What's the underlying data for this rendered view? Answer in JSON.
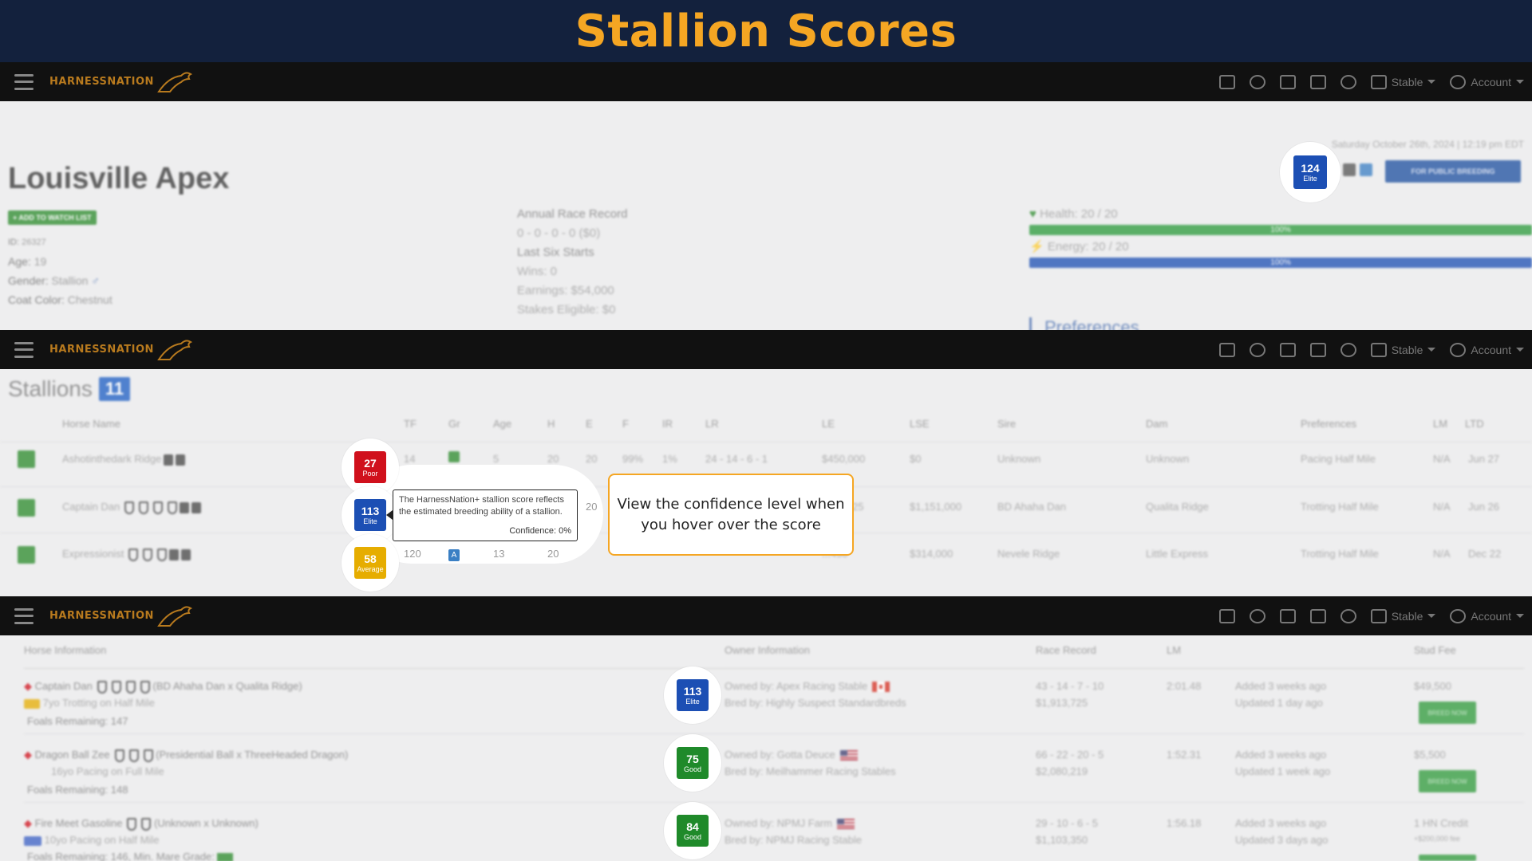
{
  "banner_title": "Stallion Scores",
  "nav": {
    "logo_text": "HARNESSNATION",
    "stable_label": "Stable",
    "account_label": "Account"
  },
  "horse_page": {
    "date": "Saturday October 26th, 2024 | 12:19 pm EDT",
    "name": "Louisville Apex",
    "watch_label": "+ ADD TO WATCH LIST",
    "id_label": "ID:",
    "id_value": "26327",
    "age_label": "Age:",
    "age_value": "19",
    "gender_label": "Gender:",
    "gender_value": "Stallion",
    "coat_label": "Coat Color:",
    "coat_value": "Chestnut",
    "annual_record_label": "Annual Race Record",
    "annual_record_value": "0 - 0 - 0 - 0 ($0)",
    "last_six_label": "Last Six Starts",
    "wins": "Wins: 0",
    "earnings": "Earnings: $54,000",
    "stakes": "Stakes Eligible: $0",
    "health_label": "Health: 20 / 20",
    "health_pct": "100%",
    "energy_label": "Energy: 20 / 20",
    "energy_pct": "100%",
    "preferences_label": "Preferences",
    "public_breeding_label": "FOR PUBLIC BREEDING",
    "score": {
      "value": "124",
      "label": "Elite"
    }
  },
  "stallions": {
    "title": "Stallions",
    "count": "11",
    "columns": [
      "Horse Name",
      "TF",
      "Gr",
      "Age",
      "H",
      "E",
      "F",
      "IR",
      "LR",
      "LE",
      "LSE",
      "Sire",
      "Dam",
      "Preferences",
      "LM",
      "LTD"
    ],
    "rows": [
      {
        "name": "Ashotinthedark Ridge",
        "tf": "14",
        "age": "5",
        "h": "20",
        "e": "20",
        "f": "99%",
        "ir": "1%",
        "lr": "24 - 14 - 6 - 1",
        "le": "$450,000",
        "lse": "$0",
        "sire": "Unknown",
        "dam": "Unknown",
        "pref": "Pacing Half Mile",
        "lm": "N/A",
        "ltd": "Jun 27",
        "score": "27",
        "score_label": "Poor"
      },
      {
        "name": "Captain Dan",
        "tf": "",
        "age": "",
        "h": "",
        "e": "20",
        "f": "",
        "ir": "",
        "lr": "",
        "le": "...725",
        "lse": "$1,151,000",
        "sire": "BD Ahaha Dan",
        "dam": "Qualita Ridge",
        "pref": "Trotting Half Mile",
        "lm": "N/A",
        "ltd": "Jun 26",
        "score": "113",
        "score_label": "Elite"
      },
      {
        "name": "Expressionist",
        "tf": "120",
        "age": "13",
        "h": "20",
        "e": "20",
        "f": "",
        "ir": "",
        "lr": "",
        "le": "...450",
        "lse": "$314,000",
        "sire": "Nevele Ridge",
        "dam": "Little Express",
        "pref": "Trotting Half Mile",
        "lm": "N/A",
        "ltd": "Dec 22",
        "score": "58",
        "score_label": "Average"
      }
    ],
    "grade_badge": "A",
    "tooltip_text": "The HarnessNation+ stallion score reflects the estimated breeding ability of a stallion.",
    "tooltip_confidence": "Confidence: 0%"
  },
  "callout_text": "View the confidence level when you hover over the score",
  "stud": {
    "headers": {
      "horse": "Horse Information",
      "owner": "Owner Information",
      "race": "Race Record",
      "lm": "LM",
      "fee": "Stud Fee"
    },
    "rows": [
      {
        "title": "Captain Dan",
        "parents": "(BD Ahaha Dan x Qualita Ridge)",
        "desc": "7yo Trotting on Half Mile",
        "foals": "Foals Remaining: 147",
        "owner": "Owned by: Apex Racing Stable",
        "breeder": "Bred by: Highly Suspect Standardbreds",
        "record": "43 - 14 - 7 - 10",
        "earnings": "$1,913,725",
        "lm": "2:01.48",
        "added": "Added 3 weeks ago",
        "updated": "Updated 1 day ago",
        "fee": "$49,500",
        "btn": "BREED NOW",
        "score": "113",
        "score_label": "Elite"
      },
      {
        "title": "Dragon Ball Zee",
        "parents": "(Presidential Ball x ThreeHeaded Dragon)",
        "desc": "16yo Pacing on Full Mile",
        "foals": "Foals Remaining: 148",
        "owner": "Owned by: Gotta Deuce",
        "breeder": "Bred by: Meilhammer Racing Stables",
        "record": "66 - 22 - 20 - 5",
        "earnings": "$2,080,219",
        "lm": "1:52.31",
        "added": "Added 3 weeks ago",
        "updated": "Updated 1 week ago",
        "fee": "$5,500",
        "btn": "BREED NOW",
        "score": "75",
        "score_label": "Good"
      },
      {
        "title": "Fire Meet Gasoline",
        "parents": "(Unknown x Unknown)",
        "desc": "10yo Pacing on Half Mile",
        "foals": "Foals Remaining: 146, Min. Mare Grade:",
        "owner": "Owned by: NPMJ Farm",
        "breeder": "Bred by: NPMJ Racing Stable",
        "record": "29 - 10 - 6 - 5",
        "earnings": "$1,103,350",
        "lm": "1:56.18",
        "added": "Added 3 weeks ago",
        "updated": "Updated 3 days ago",
        "fee": "1 HN Credit",
        "fee_sub": "+$200,000 fee",
        "score": "84",
        "score_label": "Good"
      }
    ]
  },
  "colors": {
    "banner": "#13213d",
    "title": "#f5a623",
    "elite": "#1c4fb4",
    "good": "#1f8a2a",
    "poor": "#d0101c",
    "average": "#e6ad00"
  }
}
